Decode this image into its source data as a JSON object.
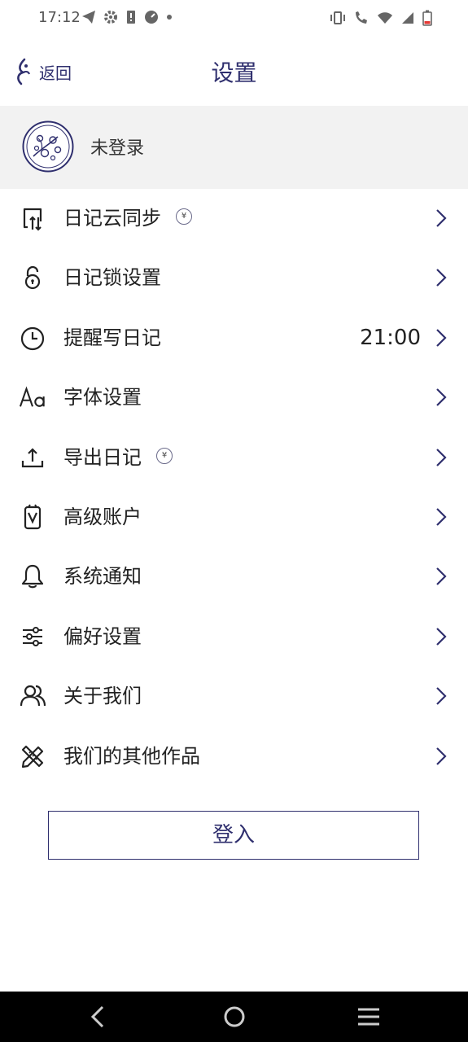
{
  "status_bar": {
    "time": "17:12"
  },
  "header": {
    "back_label": "返回",
    "title": "设置"
  },
  "profile": {
    "name": "未登录"
  },
  "menu": [
    {
      "label": "日记云同步",
      "icon": "cloud-sync-icon",
      "badge": "¥",
      "value": null
    },
    {
      "label": "日记锁设置",
      "icon": "lock-icon",
      "badge": null,
      "value": null
    },
    {
      "label": "提醒写日记",
      "icon": "clock-icon",
      "badge": null,
      "value": "21:00"
    },
    {
      "label": "字体设置",
      "icon": "font-icon",
      "badge": null,
      "value": null
    },
    {
      "label": "导出日记",
      "icon": "export-icon",
      "badge": "¥",
      "value": null
    },
    {
      "label": "高级账户",
      "icon": "premium-icon",
      "badge": null,
      "value": null
    },
    {
      "label": "系统通知",
      "icon": "bell-icon",
      "badge": null,
      "value": null
    },
    {
      "label": "偏好设置",
      "icon": "sliders-icon",
      "badge": null,
      "value": null
    },
    {
      "label": "关于我们",
      "icon": "people-icon",
      "badge": null,
      "value": null
    },
    {
      "label": "我们的其他作品",
      "icon": "pencil-ruler-icon",
      "badge": null,
      "value": null
    }
  ],
  "login_label": "登入",
  "colors": {
    "accent": "#2f2f6e",
    "profile_bg": "#f2f2f2",
    "nav_bg": "#000000"
  }
}
